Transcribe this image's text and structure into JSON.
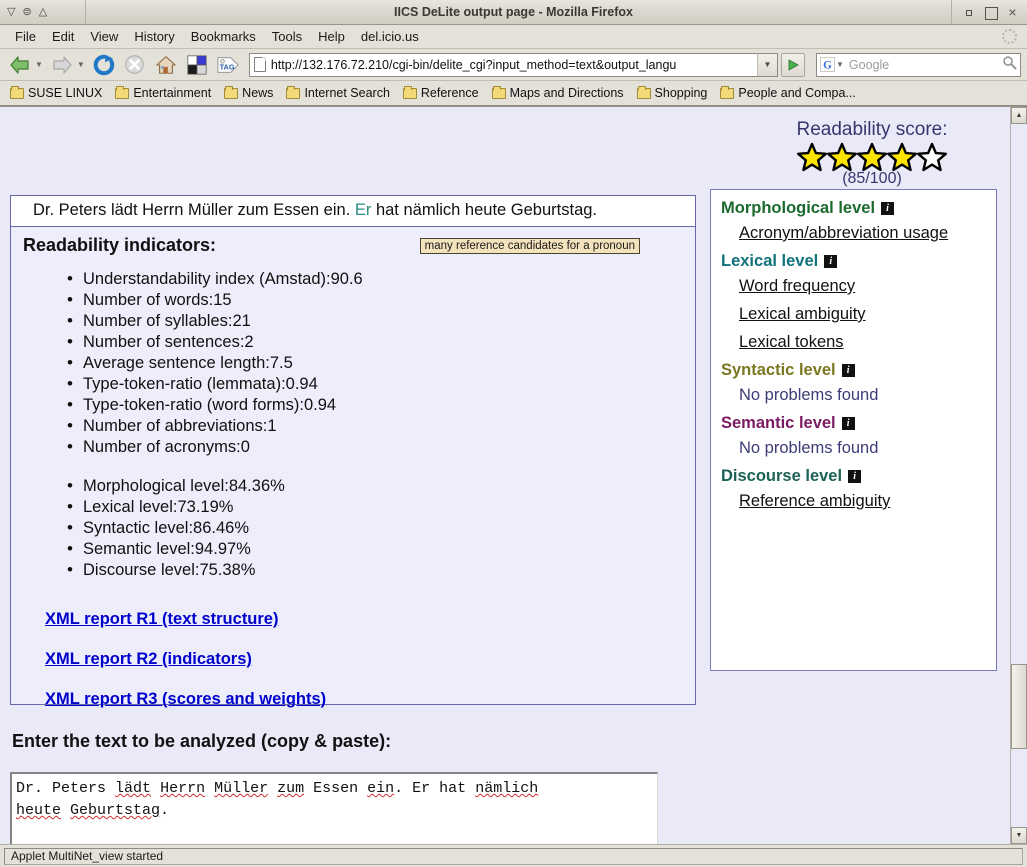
{
  "window": {
    "title": "IICS DeLite output page - Mozilla Firefox",
    "min_label": "minimize",
    "max_label": "maximize",
    "close_label": "×"
  },
  "menubar": {
    "items": [
      {
        "label": "File"
      },
      {
        "label": "Edit"
      },
      {
        "label": "View"
      },
      {
        "label": "History"
      },
      {
        "label": "Bookmarks"
      },
      {
        "label": "Tools"
      },
      {
        "label": "Help"
      },
      {
        "label": "del.icio.us"
      }
    ]
  },
  "navbar": {
    "url": "http://132.176.72.210/cgi-bin/delite_cgi?input_method=text&output_langu",
    "search_placeholder": "Google",
    "search_engine": "G",
    "go_label": "▶",
    "dropdown_label": "▼"
  },
  "bookmarks": {
    "items": [
      {
        "label": "SUSE LINUX"
      },
      {
        "label": "Entertainment"
      },
      {
        "label": "News"
      },
      {
        "label": "Internet Search"
      },
      {
        "label": "Reference"
      },
      {
        "label": "Maps and Directions"
      },
      {
        "label": "Shopping"
      },
      {
        "label": "People and Compa..."
      }
    ]
  },
  "readability": {
    "title": "Readability score:",
    "score_text": "(85/100)",
    "stars_filled": 4,
    "stars_total": 5,
    "star_fill_color": "#ffe400",
    "title_color": "#37376e"
  },
  "sentence": {
    "part1": "Dr. Peters lädt Herrn Müller zum Essen ein. ",
    "highlight": "Er",
    "highlight_color": "#2b8c84",
    "part2": " hat nämlich heute Geburtstag."
  },
  "indicators": {
    "title": "Readability indicators:",
    "tooltip": "many reference candidates for a pronoun",
    "list1": [
      "Understandability index (Amstad):90.6",
      "Number of words:15",
      "Number of syllables:21",
      "Number of sentences:2",
      "Average sentence length:7.5",
      "Type-token-ratio (lemmata):0.94",
      "Type-token-ratio (word forms):0.94",
      "Number of abbreviations:1",
      "Number of acronyms:0"
    ],
    "list2": [
      "Morphological level:84.36%",
      "Lexical level:73.19%",
      "Syntactic level:86.46%",
      "Semantic level:94.97%",
      "Discourse level:75.38%"
    ],
    "links": [
      "XML report R1 (text structure)",
      "XML report R2 (indicators)",
      "XML report R3 (scores and weights)"
    ]
  },
  "levels": {
    "groups": [
      {
        "heading": "Morphological level",
        "color": "#1c6b2e",
        "info_icon": "info-icon",
        "items": [
          {
            "label": "Acronym/abbreviation usage",
            "kind": "link"
          }
        ]
      },
      {
        "heading": "Lexical level",
        "color": "#10737b",
        "info_icon": "info-icon",
        "items": [
          {
            "label": "Word frequency",
            "kind": "link"
          },
          {
            "label": "Lexical ambiguity",
            "kind": "link"
          },
          {
            "label": "Lexical tokens",
            "kind": "link"
          }
        ]
      },
      {
        "heading": "Syntactic level",
        "color": "#7b7722",
        "info_icon": "info-icon",
        "items": [
          {
            "label": "No problems found",
            "kind": "none"
          }
        ]
      },
      {
        "heading": "Semantic level",
        "color": "#7b1a63",
        "info_icon": "info-icon",
        "items": [
          {
            "label": "No problems found",
            "kind": "none"
          }
        ]
      },
      {
        "heading": "Discourse level",
        "color": "#1c6257",
        "info_icon": "info-icon",
        "items": [
          {
            "label": "Reference ambiguity",
            "kind": "link"
          }
        ]
      }
    ]
  },
  "input_section": {
    "label": "Enter the text to be analyzed (copy & paste):",
    "line1": [
      {
        "t": "Dr. Peters ",
        "sp": false
      },
      {
        "t": "lädt",
        "sp": true
      },
      {
        "t": " ",
        "sp": false
      },
      {
        "t": "Herrn",
        "sp": true
      },
      {
        "t": " ",
        "sp": false
      },
      {
        "t": "Müller",
        "sp": true
      },
      {
        "t": " ",
        "sp": false
      },
      {
        "t": "zum",
        "sp": true
      },
      {
        "t": " Essen ",
        "sp": false
      },
      {
        "t": "ein",
        "sp": true
      },
      {
        "t": ". Er hat ",
        "sp": false
      },
      {
        "t": "nämlich",
        "sp": true
      }
    ],
    "line2": [
      {
        "t": "heute",
        "sp": true
      },
      {
        "t": " ",
        "sp": false
      },
      {
        "t": "Geburtstag",
        "sp": true
      },
      {
        "t": ".",
        "sp": false
      }
    ]
  },
  "statusbar": {
    "text": "Applet MultiNet_view started"
  }
}
